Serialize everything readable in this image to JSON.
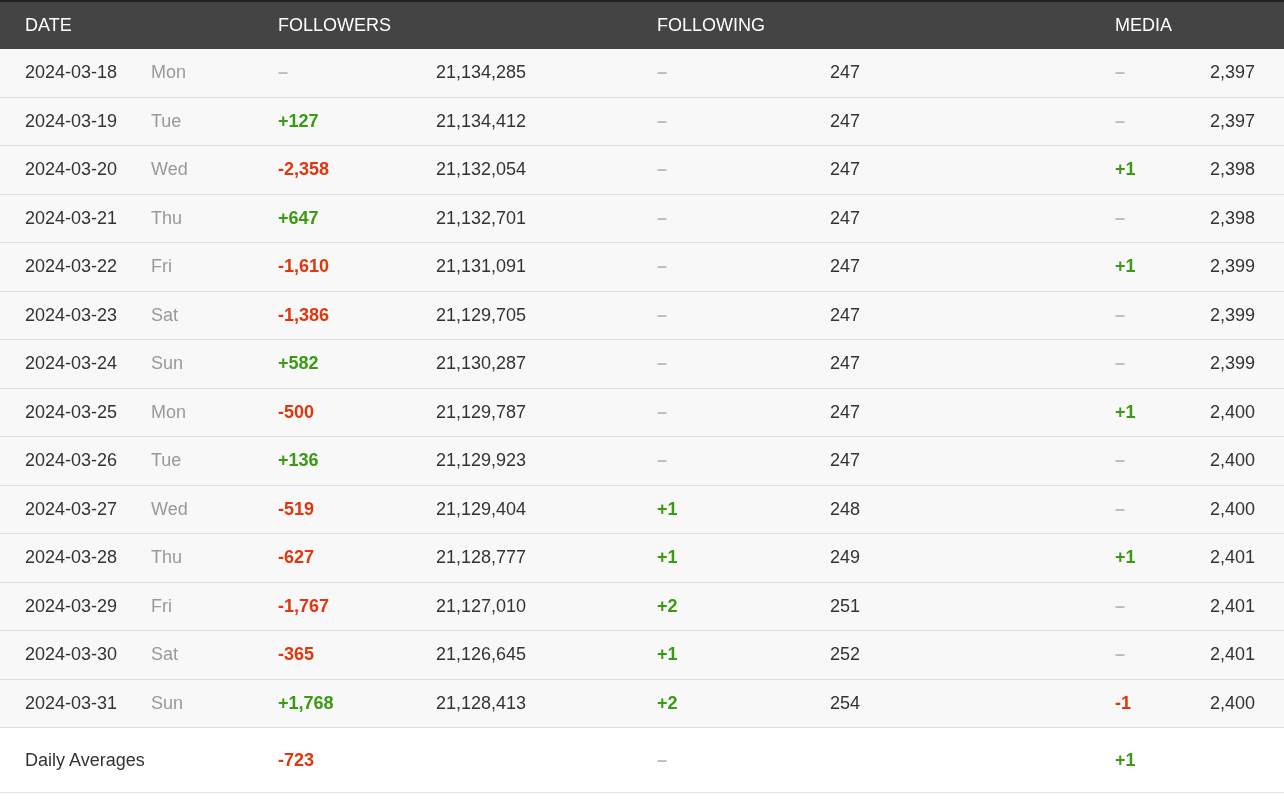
{
  "columns": [
    "DATE",
    "FOLLOWERS",
    "FOLLOWING",
    "MEDIA"
  ],
  "rows": [
    {
      "date": "2024-03-18",
      "day": "Mon",
      "followers_change": {
        "text": "–",
        "color": "#bbbbbb"
      },
      "followers": "21,134,285",
      "following_change": {
        "text": "–",
        "color": "#bbbbbb"
      },
      "following": "247",
      "media_change": {
        "text": "–",
        "color": "#bbbbbb"
      },
      "media": "2,397"
    },
    {
      "date": "2024-03-19",
      "day": "Tue",
      "followers_change": {
        "text": "+127",
        "color": "#3a9a12"
      },
      "followers": "21,134,412",
      "following_change": {
        "text": "–",
        "color": "#bbbbbb"
      },
      "following": "247",
      "media_change": {
        "text": "–",
        "color": "#bbbbbb"
      },
      "media": "2,397"
    },
    {
      "date": "2024-03-20",
      "day": "Wed",
      "followers_change": {
        "text": "-2,358",
        "color": "#e0360d"
      },
      "followers": "21,132,054",
      "following_change": {
        "text": "–",
        "color": "#bbbbbb"
      },
      "following": "247",
      "media_change": {
        "text": "+1",
        "color": "#3a9a12"
      },
      "media": "2,398"
    },
    {
      "date": "2024-03-21",
      "day": "Thu",
      "followers_change": {
        "text": "+647",
        "color": "#3a9a12"
      },
      "followers": "21,132,701",
      "following_change": {
        "text": "–",
        "color": "#bbbbbb"
      },
      "following": "247",
      "media_change": {
        "text": "–",
        "color": "#bbbbbb"
      },
      "media": "2,398"
    },
    {
      "date": "2024-03-22",
      "day": "Fri",
      "followers_change": {
        "text": "-1,610",
        "color": "#e0360d"
      },
      "followers": "21,131,091",
      "following_change": {
        "text": "–",
        "color": "#bbbbbb"
      },
      "following": "247",
      "media_change": {
        "text": "+1",
        "color": "#3a9a12"
      },
      "media": "2,399"
    },
    {
      "date": "2024-03-23",
      "day": "Sat",
      "followers_change": {
        "text": "-1,386",
        "color": "#e0360d"
      },
      "followers": "21,129,705",
      "following_change": {
        "text": "–",
        "color": "#bbbbbb"
      },
      "following": "247",
      "media_change": {
        "text": "–",
        "color": "#bbbbbb"
      },
      "media": "2,399"
    },
    {
      "date": "2024-03-24",
      "day": "Sun",
      "followers_change": {
        "text": "+582",
        "color": "#3a9a12"
      },
      "followers": "21,130,287",
      "following_change": {
        "text": "–",
        "color": "#bbbbbb"
      },
      "following": "247",
      "media_change": {
        "text": "–",
        "color": "#bbbbbb"
      },
      "media": "2,399"
    },
    {
      "date": "2024-03-25",
      "day": "Mon",
      "followers_change": {
        "text": "-500",
        "color": "#e0360d"
      },
      "followers": "21,129,787",
      "following_change": {
        "text": "–",
        "color": "#bbbbbb"
      },
      "following": "247",
      "media_change": {
        "text": "+1",
        "color": "#3a9a12"
      },
      "media": "2,400"
    },
    {
      "date": "2024-03-26",
      "day": "Tue",
      "followers_change": {
        "text": "+136",
        "color": "#3a9a12"
      },
      "followers": "21,129,923",
      "following_change": {
        "text": "–",
        "color": "#bbbbbb"
      },
      "following": "247",
      "media_change": {
        "text": "–",
        "color": "#bbbbbb"
      },
      "media": "2,400"
    },
    {
      "date": "2024-03-27",
      "day": "Wed",
      "followers_change": {
        "text": "-519",
        "color": "#e0360d"
      },
      "followers": "21,129,404",
      "following_change": {
        "text": "+1",
        "color": "#3a9a12"
      },
      "following": "248",
      "media_change": {
        "text": "–",
        "color": "#bbbbbb"
      },
      "media": "2,400"
    },
    {
      "date": "2024-03-28",
      "day": "Thu",
      "followers_change": {
        "text": "-627",
        "color": "#e0360d"
      },
      "followers": "21,128,777",
      "following_change": {
        "text": "+1",
        "color": "#3a9a12"
      },
      "following": "249",
      "media_change": {
        "text": "+1",
        "color": "#3a9a12"
      },
      "media": "2,401"
    },
    {
      "date": "2024-03-29",
      "day": "Fri",
      "followers_change": {
        "text": "-1,767",
        "color": "#e0360d"
      },
      "followers": "21,127,010",
      "following_change": {
        "text": "+2",
        "color": "#3a9a12"
      },
      "following": "251",
      "media_change": {
        "text": "–",
        "color": "#bbbbbb"
      },
      "media": "2,401"
    },
    {
      "date": "2024-03-30",
      "day": "Sat",
      "followers_change": {
        "text": "-365",
        "color": "#e0360d"
      },
      "followers": "21,126,645",
      "following_change": {
        "text": "+1",
        "color": "#3a9a12"
      },
      "following": "252",
      "media_change": {
        "text": "–",
        "color": "#bbbbbb"
      },
      "media": "2,401"
    },
    {
      "date": "2024-03-31",
      "day": "Sun",
      "followers_change": {
        "text": "+1,768",
        "color": "#3a9a12"
      },
      "followers": "21,128,413",
      "following_change": {
        "text": "+2",
        "color": "#3a9a12"
      },
      "following": "254",
      "media_change": {
        "text": "-1",
        "color": "#e0360d"
      },
      "media": "2,400"
    }
  ],
  "averages": {
    "label": "Daily Averages",
    "followers_change": {
      "text": "-723",
      "color": "#e0360d"
    },
    "following_change": {
      "text": "–",
      "color": "#bbbbbb"
    },
    "media_change": {
      "text": "+1",
      "color": "#3a9a12"
    }
  }
}
